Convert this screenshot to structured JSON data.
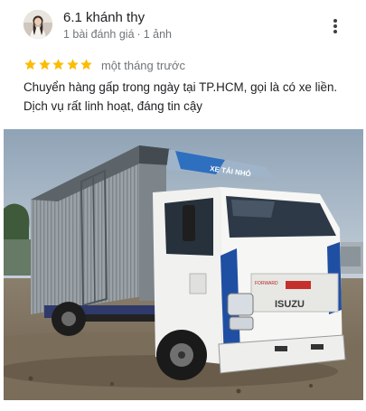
{
  "review": {
    "author_name": "6.1 khánh thy",
    "reviews_count": "1 bài đánh giá",
    "photos_count": "1 ảnh",
    "meta_separator": "·",
    "rating": 5,
    "max_rating": 5,
    "time_ago": "một tháng trước",
    "text": "Chuyển hàng gấp trong ngày tại TP.HCM, gọi là có xe liền. Dịch vụ rất linh hoạt, đáng tin cậy",
    "photo": {
      "truck_brand": "ISUZU",
      "cab_banner": "XE TẢI NHỎ",
      "grille_model": "FORWARD"
    }
  },
  "icons": {
    "star_color": "#fbbc04",
    "more_icon": "more-vert-icon"
  }
}
